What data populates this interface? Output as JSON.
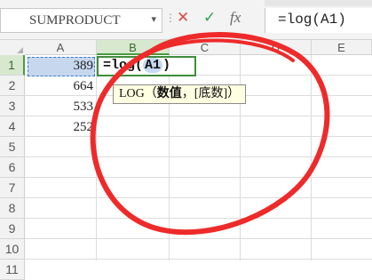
{
  "formula_bar": {
    "name_box_value": "SUMPRODUCT",
    "name_box_arrow": "▾",
    "grip": "⋮",
    "cancel_glyph": "✕",
    "enter_glyph": "✓",
    "fx_label": "fx",
    "formula_text": "=log(A1)"
  },
  "grid": {
    "columns": [
      "A",
      "B",
      "C",
      "D",
      "E"
    ],
    "rows": [
      "1",
      "2",
      "3",
      "4",
      "5",
      "6",
      "7",
      "8",
      "9",
      "10",
      "11"
    ],
    "column_a_values": [
      "389",
      "664",
      "533",
      "252"
    ],
    "active_column": "B",
    "active_row": "1",
    "editing_cell": {
      "prefix": "=log(",
      "reference": "A1",
      "suffix": ")"
    },
    "function_tooltip": {
      "fn": "LOG",
      "open": "（",
      "arg_current": "数值",
      "separator": "，",
      "arg_optional": "[底数]",
      "close": "）"
    }
  },
  "colors": {
    "selection_fill": "#c6d7ee",
    "selection_border": "#3d7cc9",
    "active_header": "#d7e8cf",
    "edit_border": "#3f8d39",
    "tooltip_bg": "#ffffe1",
    "annotation_red": "#ee2a2a"
  },
  "icons": {
    "cancel": "close-icon",
    "enter": "check-icon",
    "fx": "function-icon",
    "dropdown": "chevron-down-icon"
  }
}
